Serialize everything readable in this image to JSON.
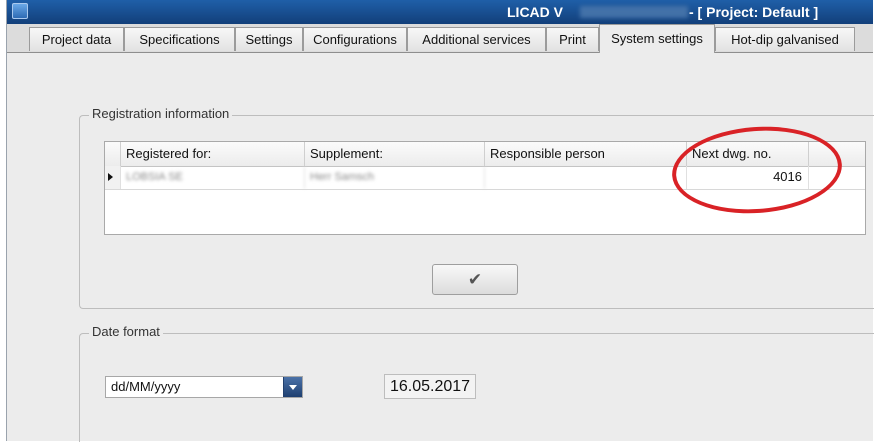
{
  "window": {
    "title_app": "LICAD V",
    "title_project": "- [ Project: Default ]"
  },
  "tabs": [
    {
      "label": "Project data"
    },
    {
      "label": "Specifications"
    },
    {
      "label": "Settings"
    },
    {
      "label": "Configurations"
    },
    {
      "label": "Additional services"
    },
    {
      "label": "Print"
    },
    {
      "label": "System settings",
      "active": true
    },
    {
      "label": "Hot-dip galvanised"
    }
  ],
  "registration": {
    "group_label": "Registration information",
    "columns": [
      "Registered for:",
      "Supplement:",
      "Responsible person",
      "Next dwg. no."
    ],
    "rows": [
      {
        "registered_for": "LOBSIA SE",
        "supplement": "Herr Samsch",
        "responsible_person": "",
        "next_dwg_no": "4016"
      }
    ],
    "ok_button_icon": "checkmark-icon",
    "ok_button_label": "✔"
  },
  "date_format": {
    "group_label": "Date format",
    "selected_format": "dd/MM/yyyy",
    "preview_date": "16.05.2017"
  },
  "colors": {
    "titlebar": "#1f5fa8",
    "highlight_circle": "#d92226"
  }
}
